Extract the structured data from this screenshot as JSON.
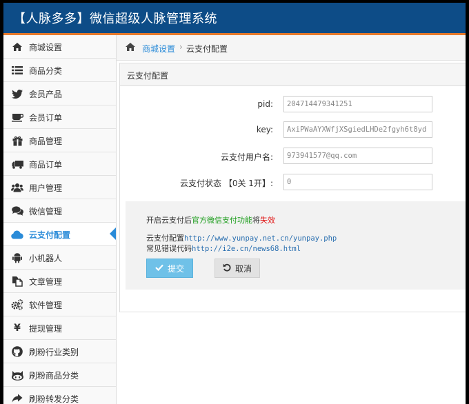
{
  "header": {
    "title": "【人脉多多】微信超级人脉管理系统"
  },
  "sidebar": {
    "items": [
      {
        "label": "商城设置",
        "icon": "home-icon"
      },
      {
        "label": "商品分类",
        "icon": "list-icon"
      },
      {
        "label": "会员产品",
        "icon": "twitter-icon"
      },
      {
        "label": "会员订单",
        "icon": "coffee-icon"
      },
      {
        "label": "商品管理",
        "icon": "gift-icon"
      },
      {
        "label": "商品订单",
        "icon": "truck-icon"
      },
      {
        "label": "用户管理",
        "icon": "users-icon"
      },
      {
        "label": "微信管理",
        "icon": "comments-icon"
      },
      {
        "label": "云支付配置",
        "icon": "cloud-icon"
      },
      {
        "label": "小机器人",
        "icon": "android-icon"
      },
      {
        "label": "文章管理",
        "icon": "copy-icon"
      },
      {
        "label": "软件管理",
        "icon": "cogs-icon"
      },
      {
        "label": "提现管理",
        "icon": "yen-icon"
      },
      {
        "label": "刷粉行业类别",
        "icon": "github-icon"
      },
      {
        "label": "刷粉商品分类",
        "icon": "octocat-icon"
      },
      {
        "label": "刷粉转发分类",
        "icon": "share-icon"
      }
    ],
    "active_index": 8,
    "accent_color": "#2a8bd8"
  },
  "breadcrumb": {
    "link": "商城设置",
    "separator": "›",
    "current": "云支付配置"
  },
  "panel": {
    "title": "云支付配置",
    "fields": [
      {
        "label": "pid:",
        "value": "204714479341251"
      },
      {
        "label": "key:",
        "value": "AxiPWaAYXWfjXSgiedLHDe2fgyh6t8yd"
      },
      {
        "label": "云支付用户名:",
        "value": "973941577@qq.com"
      },
      {
        "label": "云支付状态 【0关 1开】:",
        "value": "0"
      }
    ],
    "notice": {
      "line1_prefix": "开启云支付后",
      "line1_green": "官方微信支付功能",
      "line1_mid": "将",
      "line1_red": "失效",
      "line2_label": "云支付配置",
      "line2_link": "http://www.yunpay.net.cn/yunpay.php",
      "line3_label": "常见错误代码",
      "line3_link": "http://i2e.cn/news68.html"
    },
    "submit_label": "提交",
    "cancel_label": "取消"
  },
  "colors": {
    "header_bg": "#0d4c87",
    "header_border": "#e87a2b",
    "submit_bg": "#6fc1e8",
    "green_text": "#1a9c1a",
    "red_text": "#e01010"
  }
}
